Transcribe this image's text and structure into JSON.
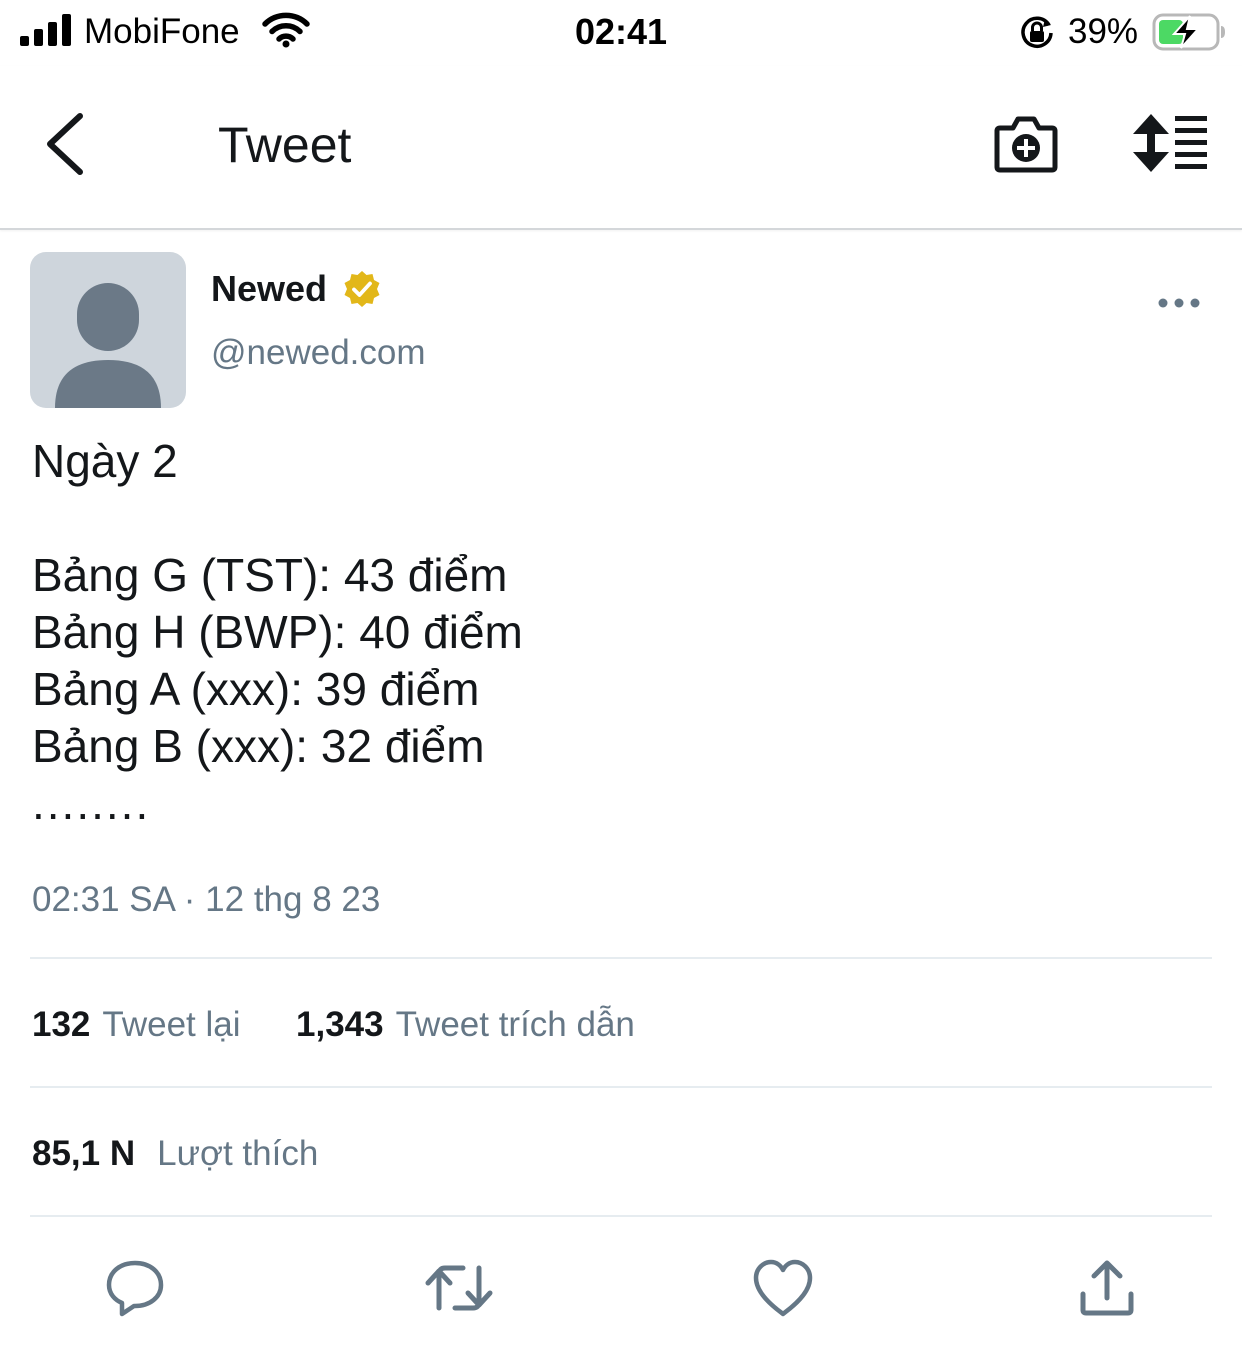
{
  "status_bar": {
    "carrier": "MobiFone",
    "time": "02:41",
    "battery_percent": "39%"
  },
  "nav": {
    "title": "Tweet",
    "icons": [
      "back-arrow-icon",
      "camera-add-icon",
      "sort-icon"
    ]
  },
  "tweet": {
    "author": {
      "name": "Newed",
      "handle": "@newed.com",
      "verified_badge_color": "#e2b719"
    },
    "text": {
      "line1": "Ngày 2",
      "line2": "Bảng G (TST): 43 điểm",
      "line3": "Bảng H (BWP): 40 điểm",
      "line4": "Bảng A (xxx): 39 điểm",
      "line5": "Bảng B (xxx): 32 điểm",
      "line6": "........"
    },
    "timestamp": "02:31 SA · 12 thg 8 23",
    "stats": {
      "retweets": {
        "count": "132",
        "label": "Tweet lại"
      },
      "quotes": {
        "count": "1,343",
        "label": "Tweet trích dẫn"
      },
      "likes": {
        "count": "85,1 N",
        "label": "Lượt thích"
      }
    },
    "actions": [
      "reply-icon",
      "retweet-icon",
      "like-icon",
      "share-icon"
    ]
  },
  "colors": {
    "primary_text": "#14171a",
    "secondary_text": "#657786",
    "divider": "#e6ecf0",
    "icon": "#657786"
  }
}
